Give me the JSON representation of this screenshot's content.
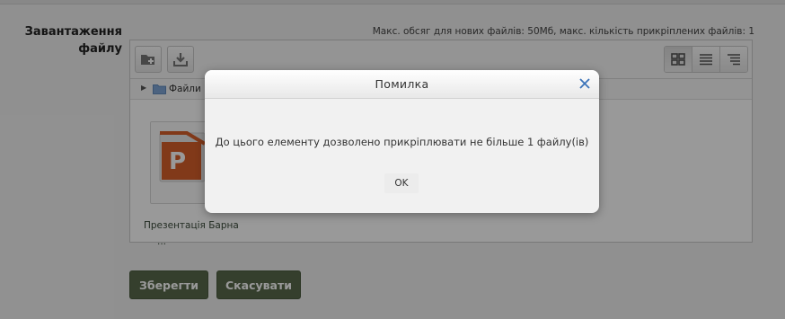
{
  "field": {
    "label": "Завантаження файлу",
    "limits": "Макс. обсяг для нових файлів: 50Мб, макс. кількість прикріплених файлів: 1"
  },
  "file_manager": {
    "toolbar": {
      "add_folder_icon": "folder-add-icon",
      "download_icon": "download-icon",
      "views": [
        "grid-view-icon",
        "list-view-icon",
        "tree-view-icon"
      ]
    },
    "path": {
      "label": "Файли"
    },
    "files": [
      {
        "name_line1": "Презентація Барна",
        "name_line2": "...",
        "icon": "powerpoint-file-icon"
      }
    ]
  },
  "form_buttons": {
    "save": "Зберегти",
    "cancel": "Скасувати"
  },
  "dialog": {
    "title": "Помилка",
    "message": "До цього елементу дозволено прикріплювати не більше 1 файлу(ів)",
    "ok": "OK"
  },
  "colors": {
    "primary_button": "#59694c",
    "close_icon": "#3b73b9"
  }
}
